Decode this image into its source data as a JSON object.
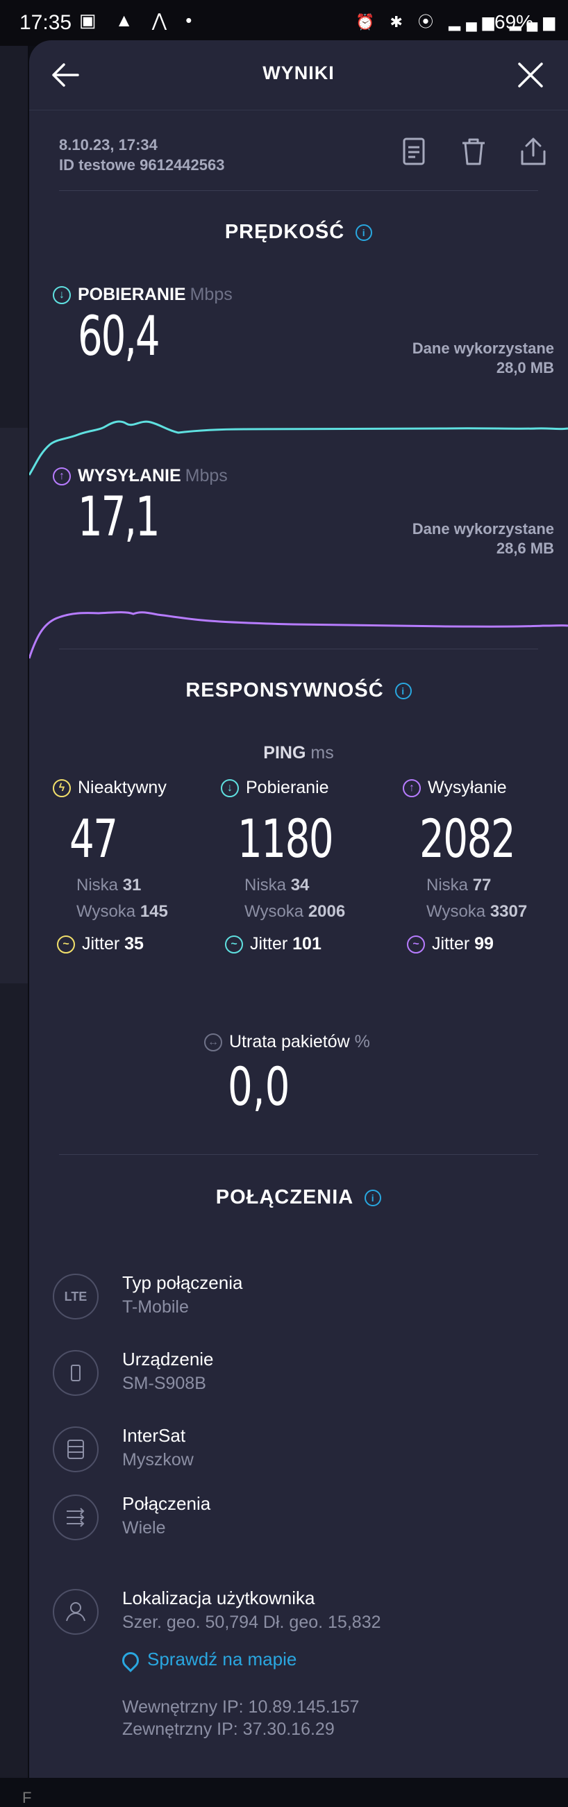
{
  "status_bar": {
    "time": "17:35",
    "battery": "69%"
  },
  "header": {
    "title": "WYNIKI"
  },
  "test": {
    "date": "8.10.23, 17:34",
    "id": "ID testowe 9612442563"
  },
  "speed": {
    "section_title": "PRĘDKOŚĆ",
    "download": {
      "label": "POBIERANIE",
      "unit": "Mbps",
      "value": "60,4",
      "used_label": "Dane wykorzystane",
      "used_value": "28,0 MB"
    },
    "upload": {
      "label": "WYSYŁANIE",
      "unit": "Mbps",
      "value": "17,1",
      "used_label": "Dane wykorzystane",
      "used_value": "28,6 MB"
    }
  },
  "responsiveness": {
    "section_title": "RESPONSYWNOŚĆ",
    "ping_label": "PING",
    "ping_unit": "ms",
    "columns": [
      {
        "label": "Nieaktywny",
        "value": "47",
        "low_label": "Niska",
        "low": "31",
        "high_label": "Wysoka",
        "high": "145",
        "jitter_label": "Jitter",
        "jitter": "35",
        "color": "#f2e06b"
      },
      {
        "label": "Pobieranie",
        "value": "1180",
        "low_label": "Niska",
        "low": "34",
        "high_label": "Wysoka",
        "high": "2006",
        "jitter_label": "Jitter",
        "jitter": "101",
        "color": "#5fe0e0"
      },
      {
        "label": "Wysyłanie",
        "value": "2082",
        "low_label": "Niska",
        "low": "77",
        "high_label": "Wysoka",
        "high": "3307",
        "jitter_label": "Jitter",
        "jitter": "99",
        "color": "#b77cff"
      }
    ],
    "packet_loss_label": "Utrata pakietów",
    "packet_loss_unit": "%",
    "packet_loss_value": "0,0"
  },
  "connections": {
    "section_title": "POŁĄCZENIA",
    "items": [
      {
        "icon": "lte-icon",
        "icon_text": "LTE",
        "title": "Typ połączenia",
        "subtitle": "T-Mobile"
      },
      {
        "icon": "phone-icon",
        "title": "Urządzenie",
        "subtitle": "SM-S908B"
      },
      {
        "icon": "server-icon",
        "title": "InterSat",
        "subtitle": "Myszkow"
      },
      {
        "icon": "multi-connection-icon",
        "title": "Połączenia",
        "subtitle": "Wiele"
      },
      {
        "icon": "user-icon",
        "title": "Lokalizacja użytkownika",
        "subtitle": "Szer. geo. 50,794 Dł. geo. 15,832"
      }
    ],
    "map_link": "Sprawdź na mapie",
    "internal_ip": "Wewnętrzny IP: 10.89.145.157",
    "external_ip": "Zewnętrzny IP: 37.30.16.29"
  },
  "colors": {
    "download": "#5fe0e0",
    "upload": "#b77cff",
    "accent": "#29a8e0",
    "idle": "#f2e06b"
  }
}
